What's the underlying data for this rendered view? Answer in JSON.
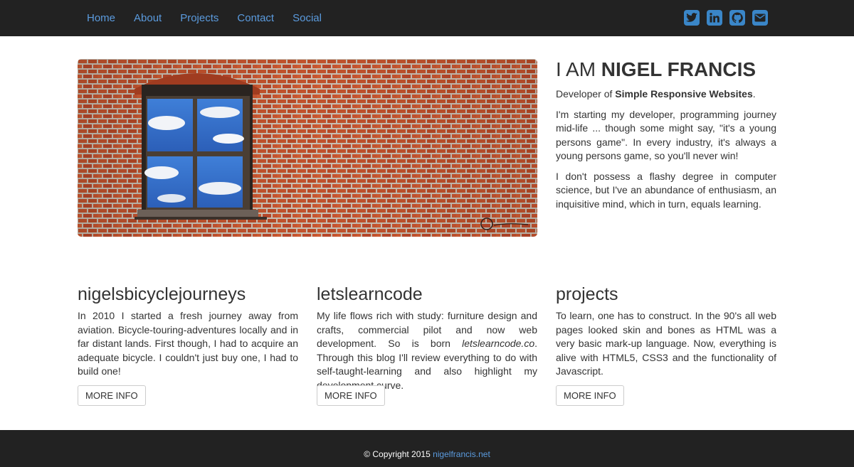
{
  "nav": {
    "items": [
      {
        "label": "Home"
      },
      {
        "label": "About"
      },
      {
        "label": "Projects"
      },
      {
        "label": "Contact"
      },
      {
        "label": "Social"
      }
    ],
    "social": [
      "twitter-icon",
      "linkedin-icon",
      "github-icon",
      "email-icon"
    ],
    "accent_color": "#3a86c8",
    "link_color": "#5b9bde"
  },
  "intro": {
    "heading_prefix": "I AM",
    "heading_name": "NIGEL FRANCIS",
    "role_prefix": "Developer of",
    "role_strong": "Simple Responsive Websites",
    "role_suffix": ".",
    "p1": "I'm starting my developer, programming journey mid-life ... though some might say, \"it's a young persons game\". In every industry, it's always a young persons game, so you'll never win!",
    "p2": "I don't possess a flashy degree in computer science, but I've an abundance of enthusiasm, an inquisitive mind, which in turn, equals learning."
  },
  "hero": {
    "image": "brick-wall-window"
  },
  "columns": [
    {
      "title": "nigelsbicyclejourneys",
      "text": "In 2010 I started a fresh journey away from aviation. Bicycle-touring-adventures locally and in far distant lands. First though, I had to acquire an adequate bicycle. I couldn't just buy one, I had to build one!",
      "button": "MORE INFO"
    },
    {
      "title": "letslearncode",
      "text_before": "My life flows rich with study: furniture design and crafts, commercial pilot and now web development. So is born ",
      "text_italic": "letslearncode.co",
      "text_after": ". Through this blog I'll review everything to do with self-taught-learning and also highlight my development curve.",
      "button": "MORE INFO"
    },
    {
      "title": "projects",
      "text": "To learn, one has to construct. In the 90's all web pages looked skin and bones as HTML was a very basic mark-up language. Now, everything is alive with HTML5, CSS3 and the functionality of Javascript.",
      "button": "MORE INFO"
    }
  ],
  "footer": {
    "copyright": "© Copyright 2015",
    "link": "nigelfrancis.net"
  }
}
